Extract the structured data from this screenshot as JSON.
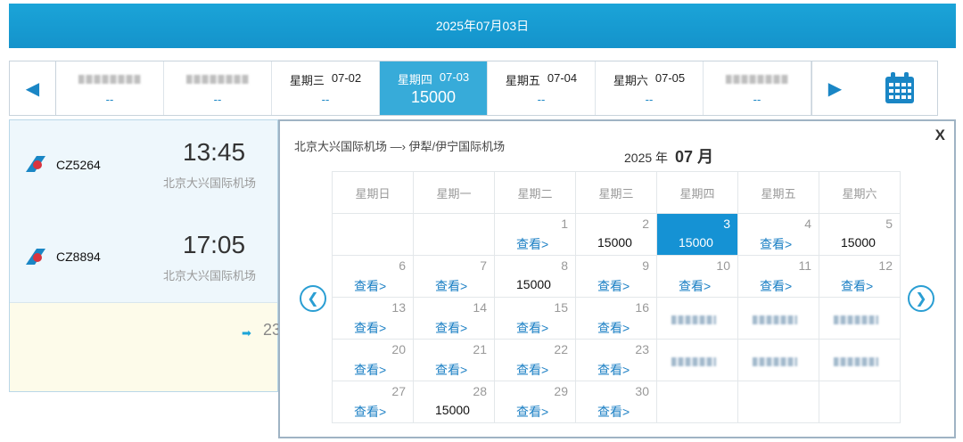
{
  "header": {
    "date": "2025年07月03日"
  },
  "strip": {
    "days": [
      {
        "label": "",
        "date": "",
        "price": "--",
        "blurred": true
      },
      {
        "label": "",
        "date": "",
        "price": "--",
        "blurred": true
      },
      {
        "label": "星期三",
        "date": "07-02",
        "price": "--",
        "blurred": false
      },
      {
        "label": "星期四",
        "date": "07-03",
        "price": "15000",
        "blurred": false,
        "active": true
      },
      {
        "label": "星期五",
        "date": "07-04",
        "price": "--",
        "blurred": false
      },
      {
        "label": "星期六",
        "date": "07-05",
        "price": "--",
        "blurred": false
      },
      {
        "label": "",
        "date": "",
        "price": "--",
        "blurred": true
      }
    ]
  },
  "flights": [
    {
      "code": "CZ5264",
      "time": "13:45",
      "airport": "北京大兴国际机场"
    },
    {
      "code": "CZ8894",
      "time": "17:05",
      "airport": "北京大兴国际机场"
    }
  ],
  "more": {
    "num": "23"
  },
  "popup": {
    "route": "北京大兴国际机场 —› 伊犁/伊宁国际机场",
    "year_label": "2025 年",
    "month": "07 月",
    "close": "X",
    "weekdays": [
      "星期日",
      "星期一",
      "星期二",
      "星期三",
      "星期四",
      "星期五",
      "星期六"
    ],
    "weeks": [
      [
        {
          "d": ""
        },
        {
          "d": ""
        },
        {
          "d": "1",
          "t": "查看>"
        },
        {
          "d": "2",
          "v": "15000"
        },
        {
          "d": "3",
          "v": "15000",
          "sel": true
        },
        {
          "d": "4",
          "t": "查看>"
        },
        {
          "d": "5",
          "v": "15000"
        }
      ],
      [
        {
          "d": "6",
          "t": "查看>"
        },
        {
          "d": "7",
          "t": "查看>"
        },
        {
          "d": "8",
          "v": "15000"
        },
        {
          "d": "9",
          "t": "查看>"
        },
        {
          "d": "10",
          "t": "查看>"
        },
        {
          "d": "11",
          "t": "查看>"
        },
        {
          "d": "12",
          "t": "查看>"
        }
      ],
      [
        {
          "d": "13",
          "t": "查看>"
        },
        {
          "d": "14",
          "t": "查看>"
        },
        {
          "d": "15",
          "t": "查看>"
        },
        {
          "d": "16",
          "t": "查看>"
        },
        {
          "d": "",
          "b": true
        },
        {
          "d": "",
          "b": true
        },
        {
          "d": "",
          "b": true
        }
      ],
      [
        {
          "d": "20",
          "t": "查看>"
        },
        {
          "d": "21",
          "t": "查看>"
        },
        {
          "d": "22",
          "t": "查看>"
        },
        {
          "d": "23",
          "t": "查看>"
        },
        {
          "d": "",
          "b": true
        },
        {
          "d": "",
          "b": true
        },
        {
          "d": "",
          "b": true
        }
      ],
      [
        {
          "d": "27",
          "t": "查看>"
        },
        {
          "d": "28",
          "v": "15000"
        },
        {
          "d": "29",
          "t": "查看>"
        },
        {
          "d": "30",
          "t": "查看>"
        },
        {
          "d": ""
        },
        {
          "d": ""
        },
        {
          "d": ""
        }
      ]
    ]
  },
  "colors": {
    "accent": "#1592d4",
    "banner": "#1ba4d8",
    "link": "#1a7fc4"
  }
}
